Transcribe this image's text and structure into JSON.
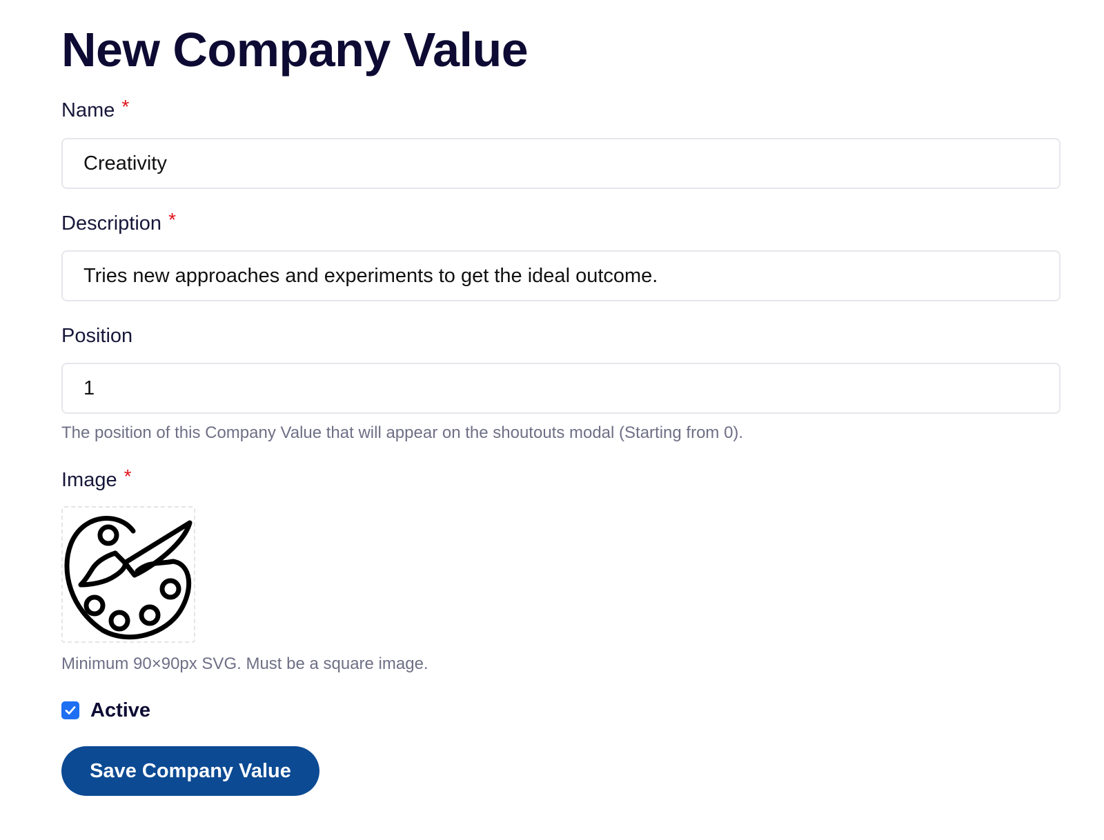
{
  "page": {
    "title": "New Company Value"
  },
  "form": {
    "name": {
      "label": "Name",
      "required_marker": "*",
      "value": "Creativity"
    },
    "description": {
      "label": "Description",
      "required_marker": "*",
      "value": "Tries new approaches and experiments to get the ideal outcome."
    },
    "position": {
      "label": "Position",
      "value": "1",
      "help": "The position of this Company Value that will appear on the shoutouts modal (Starting from 0)."
    },
    "image": {
      "label": "Image",
      "required_marker": "*",
      "icon": "paint-palette-icon",
      "help": "Minimum 90×90px SVG. Must be a square image."
    },
    "active": {
      "label": "Active",
      "checked": true
    },
    "submit_label": "Save Company Value"
  },
  "colors": {
    "title": "#0d0b33",
    "required": "#e0131b",
    "help_text": "#6e6f86",
    "checkbox": "#1e6ff2",
    "button": "#0c4a93"
  }
}
